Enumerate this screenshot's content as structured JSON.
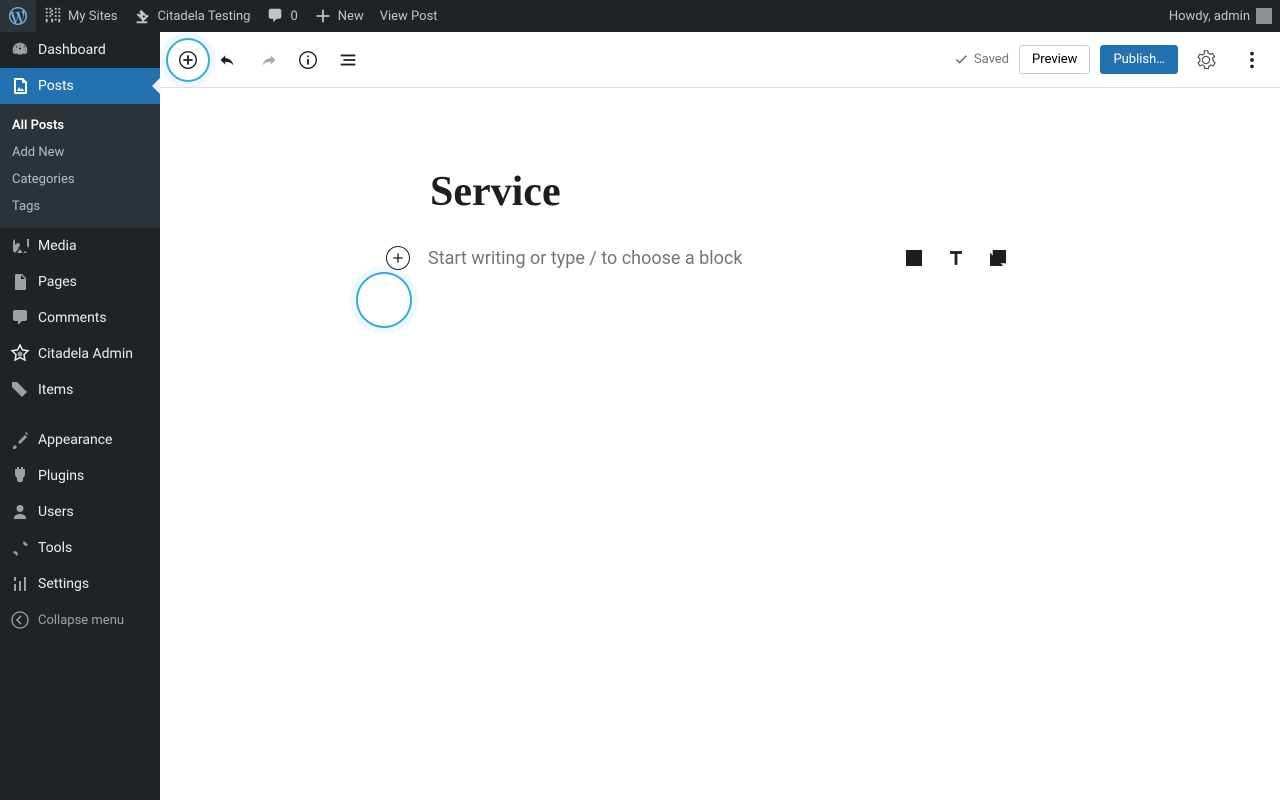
{
  "adminbar": {
    "my_sites": "My Sites",
    "site_name": "Citadela Testing",
    "comments": "0",
    "new": "New",
    "view_post": "View Post",
    "howdy": "Howdy, admin"
  },
  "sidebar": {
    "dashboard": "Dashboard",
    "posts": "Posts",
    "posts_sub": {
      "all": "All Posts",
      "add": "Add New",
      "categories": "Categories",
      "tags": "Tags"
    },
    "media": "Media",
    "pages": "Pages",
    "comments": "Comments",
    "citadela": "Citadela Admin",
    "items": "Items",
    "appearance": "Appearance",
    "plugins": "Plugins",
    "users": "Users",
    "tools": "Tools",
    "settings": "Settings",
    "collapse": "Collapse menu"
  },
  "header": {
    "saved": "Saved",
    "preview": "Preview",
    "publish": "Publish…"
  },
  "editor": {
    "title": "Service",
    "placeholder": "Start writing or type / to choose a block"
  }
}
